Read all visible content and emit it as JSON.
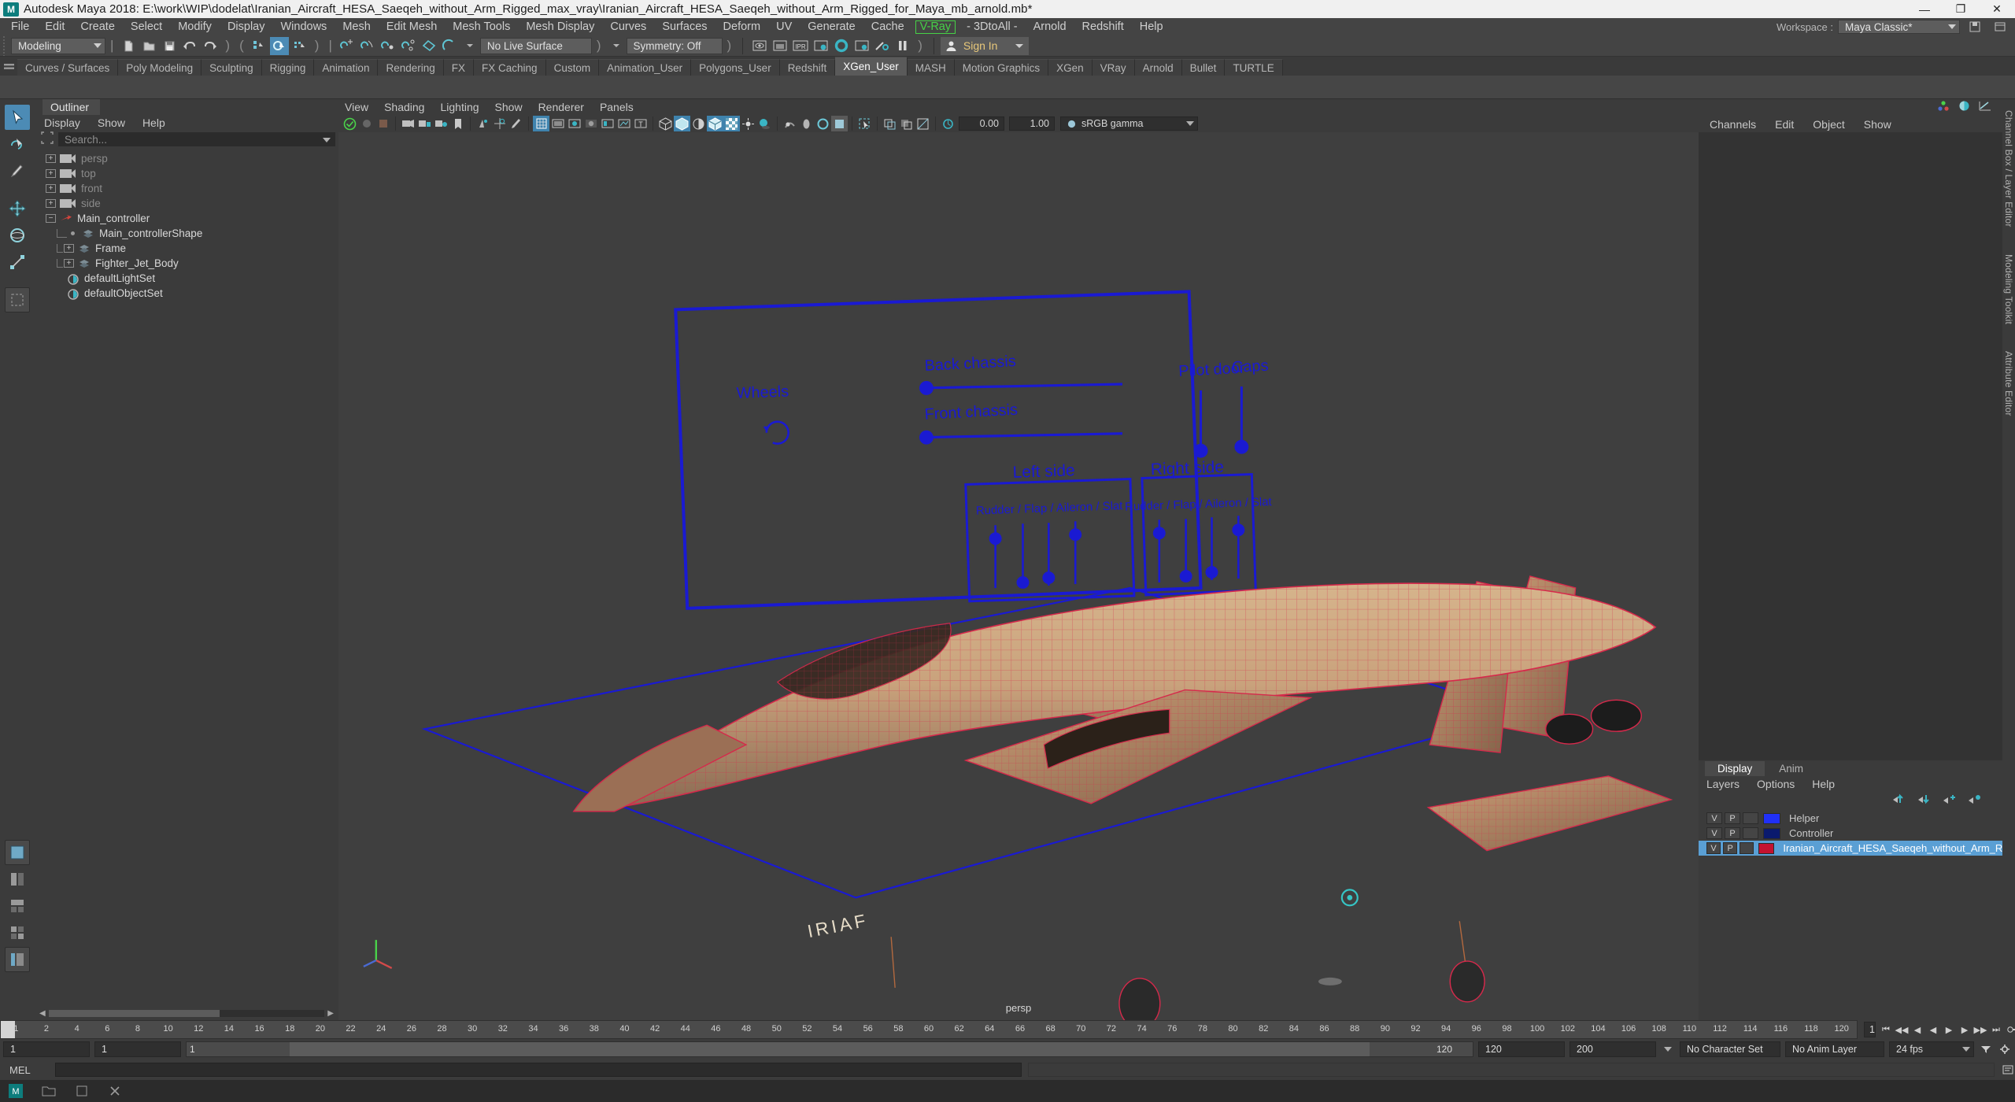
{
  "titlebar": {
    "app_icon": "maya-logo-icon",
    "text": "Autodesk Maya 2018: E:\\work\\WIP\\dodelat\\Iranian_Aircraft_HESA_Saeqeh_without_Arm_Rigged_max_vray\\Iranian_Aircraft_HESA_Saeqeh_without_Arm_Rigged_for_Maya_mb_arnold.mb*",
    "minimize": "—",
    "maximize": "❐",
    "close": "✕"
  },
  "menubar": {
    "items": [
      "File",
      "Edit",
      "Create",
      "Select",
      "Modify",
      "Display",
      "Windows",
      "Mesh",
      "Edit Mesh",
      "Mesh Tools",
      "Mesh Display",
      "Curves",
      "Surfaces",
      "Deform",
      "UV",
      "Generate",
      "Cache"
    ],
    "highlight": "V-Ray",
    "items_after": [
      "- 3DtoAll -",
      "Arnold",
      "Redshift",
      "Help"
    ],
    "highlight_color": "#46d246",
    "workspace_label": "Workspace :",
    "workspace_value": "Maya Classic*"
  },
  "statusbar": {
    "menuset": "Modeling",
    "live_surface": "No Live Surface",
    "symmetry": "Symmetry: Off",
    "signin": "Sign In",
    "icons": [
      "new-scene-icon",
      "open-scene-icon",
      "save-scene-icon",
      "undo-icon",
      "redo-icon",
      "select-hierarchy-icon",
      "select-object-icon",
      "select-component-icon",
      "snap-grid-icon",
      "snap-curve-icon",
      "snap-point-icon",
      "snap-projected-icon",
      "snap-view-plane-icon",
      "make-live-icon",
      "render-view-icon",
      "render-region-icon",
      "ipr-render-icon",
      "render-settings-icon",
      "hypershade-icon",
      "render-setup-icon",
      "light-editor-icon",
      "pause-icon",
      "user-avatar-icon",
      "chevron-down-icon"
    ]
  },
  "shelf": {
    "tabs": [
      "Curves / Surfaces",
      "Poly Modeling",
      "Sculpting",
      "Rigging",
      "Animation",
      "Rendering",
      "FX",
      "FX Caching",
      "Custom",
      "Animation_User",
      "Polygons_User",
      "Redshift",
      "XGen_User",
      "MASH",
      "Motion Graphics",
      "XGen",
      "VRay",
      "Arnold",
      "Bullet",
      "TURTLE"
    ],
    "active_tab": "XGen_User"
  },
  "outliner": {
    "tab": "Outliner",
    "menus": [
      "Display",
      "Show",
      "Help"
    ],
    "search_placeholder": "Search...",
    "items": [
      {
        "label": "persp",
        "indent": 0,
        "expander": "+",
        "icon": "camera-icon",
        "dim": true
      },
      {
        "label": "top",
        "indent": 0,
        "expander": "+",
        "icon": "camera-icon",
        "dim": true
      },
      {
        "label": "front",
        "indent": 0,
        "expander": "+",
        "icon": "camera-icon",
        "dim": true
      },
      {
        "label": "side",
        "indent": 0,
        "expander": "+",
        "icon": "camera-icon",
        "dim": true
      },
      {
        "label": "Main_controller",
        "indent": 0,
        "expander": "-",
        "icon": "transform-arrow-icon",
        "dim": false
      },
      {
        "label": "Main_controllerShape",
        "indent": 1,
        "expander": "dot",
        "icon": "mesh-icon",
        "dim": false
      },
      {
        "label": "Frame",
        "indent": 1,
        "expander": "+",
        "icon": "mesh-icon",
        "dim": false
      },
      {
        "label": "Fighter_Jet_Body",
        "indent": 1,
        "expander": "+",
        "icon": "mesh-icon",
        "dim": false
      },
      {
        "label": "defaultLightSet",
        "indent": 1,
        "expander": "none",
        "icon": "set-icon",
        "dim": false
      },
      {
        "label": "defaultObjectSet",
        "indent": 1,
        "expander": "none",
        "icon": "set-icon",
        "dim": false
      }
    ]
  },
  "viewport": {
    "menus": [
      "View",
      "Shading",
      "Lighting",
      "Show",
      "Renderer",
      "Panels"
    ],
    "exposure_value": "0.00",
    "gamma_value": "1.00",
    "color_space": "sRGB gamma",
    "camera_label": "persp",
    "toolbar_icons": [
      "select-camera-icon",
      "camera-attributes-icon",
      "bookmark-icon",
      "image-plane-icon",
      "two-d-pan-zoom-icon",
      "grease-pencil-icon",
      "grid-icon",
      "film-gate-icon",
      "resolution-gate-icon",
      "gate-mask-icon",
      "film-origin-icon",
      "exposure-icon",
      "hud-text-icon",
      "wireframe-icon",
      "smooth-shade-icon",
      "flat-shade-icon",
      "shaded-wireframe-icon",
      "textured-icon",
      "use-lights-icon",
      "shadows-icon",
      "ao-icon",
      "motion-blur-icon",
      "aa-icon",
      "isolate-select-icon",
      "xray-icon",
      "xray-joints-icon",
      "xray-active-components-icon",
      "exposure-gamma-icon"
    ],
    "overlay": {
      "panel_title_rows": [
        {
          "label": "Wheels"
        },
        {
          "label": "Back chassis"
        },
        {
          "label": "Pilot door"
        },
        {
          "label": "Caps"
        },
        {
          "label": "Front chassis"
        },
        {
          "label": "Left side"
        },
        {
          "label": "Right side"
        },
        {
          "label": "Rudder / Flap / Aileron / Slat"
        },
        {
          "label": "Rudder / Flap / Aileron / Slat"
        }
      ]
    }
  },
  "channelbox": {
    "menus": [
      "Channels",
      "Edit",
      "Object",
      "Show"
    ],
    "side_tabs": [
      "Channel Box / Layer Editor",
      "Modeling Toolkit",
      "Attribute Editor"
    ],
    "icons": [
      "channel-box-icon",
      "attribute-editor-icon",
      "graph-editor-icon"
    ]
  },
  "layereditor": {
    "tabs": [
      "Display",
      "Anim"
    ],
    "active_tab": "Display",
    "menus": [
      "Layers",
      "Options",
      "Help"
    ],
    "toolbar_icons": [
      "move-layer-up-icon",
      "move-layer-down-icon",
      "new-layer-icon",
      "new-layer-from-selected-icon"
    ],
    "columns": [
      "V",
      "P"
    ],
    "layers": [
      {
        "v": "V",
        "p": "P",
        "color": "#2030f8",
        "name": "Helper",
        "selected": false
      },
      {
        "v": "V",
        "p": "P",
        "color": "#0a1a6e",
        "name": "Controller",
        "selected": false
      },
      {
        "v": "V",
        "p": "P",
        "color": "#c41230",
        "name": "Iranian_Aircraft_HESA_Saeqeh_without_Arm_Rigged",
        "selected": true
      }
    ]
  },
  "timeline": {
    "ticks": [
      "1",
      "2",
      "4",
      "6",
      "8",
      "10",
      "12",
      "14",
      "16",
      "18",
      "20",
      "22",
      "24",
      "26",
      "28",
      "30",
      "32",
      "34",
      "36",
      "38",
      "40",
      "42",
      "44",
      "46",
      "48",
      "50",
      "52",
      "54",
      "56",
      "58",
      "60",
      "62",
      "64",
      "66",
      "68",
      "70",
      "72",
      "74",
      "76",
      "78",
      "80",
      "82",
      "84",
      "86",
      "88",
      "90",
      "92",
      "94",
      "96",
      "98",
      "100",
      "102",
      "104",
      "106",
      "108",
      "110",
      "112",
      "114",
      "116",
      "118",
      "120"
    ],
    "current_frame": "1",
    "range_start": "1",
    "range_end": "120",
    "playback_start": "1",
    "playback_end": "120",
    "anim_start": "120",
    "anim_end": "200",
    "character_set": "No Character Set",
    "anim_layer": "No Anim Layer",
    "fps": "24 fps",
    "frame_field": "1",
    "keys_field": "1",
    "playback_buttons": [
      "go-to-start-icon",
      "step-back-frame-icon",
      "step-back-key-icon",
      "play-backwards-icon",
      "play-forwards-icon",
      "step-forward-key-icon",
      "step-forward-frame-icon",
      "go-to-end-icon",
      "auto-key-icon",
      "anim-prefs-icon"
    ]
  },
  "commandline": {
    "language": "MEL",
    "input_value": "",
    "output_value": ""
  },
  "taskbar": {
    "items": [
      "maya-taskbar-icon",
      "folder-taskbar-icon",
      "window-taskbar-icon",
      "close-taskbar-icon"
    ]
  },
  "colors": {
    "accent_blue": "#4c8bb5",
    "vray_green": "#46d246",
    "layer_selected": "#5a9fd4",
    "overlay_blue": "#1a1ad2",
    "model_red": "#d6294b"
  }
}
